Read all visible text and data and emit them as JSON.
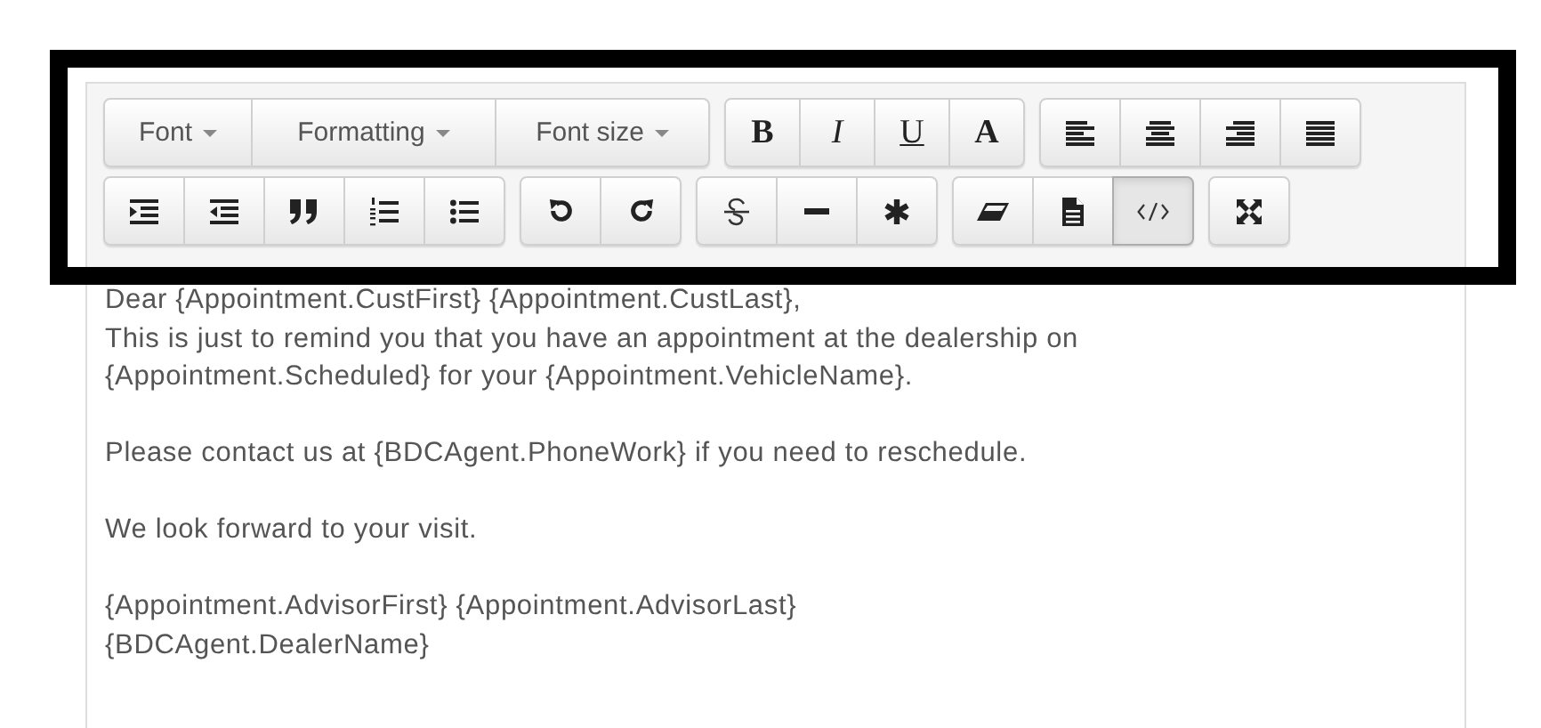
{
  "toolbar": {
    "rows": [
      [
        {
          "buttons": [
            {
              "kind": "dropdown",
              "label": "Font",
              "active": false
            },
            {
              "kind": "dropdown",
              "label": "Formatting",
              "active": false
            },
            {
              "kind": "dropdown",
              "label": "Font size",
              "active": false
            }
          ]
        },
        {
          "buttons": [
            {
              "kind": "letter",
              "label": "B",
              "active": false
            },
            {
              "kind": "letter",
              "label": "I",
              "active": false
            },
            {
              "kind": "letter",
              "label": "U",
              "active": false
            },
            {
              "kind": "letter",
              "label": "A",
              "active": false
            }
          ]
        },
        {
          "buttons": [
            {
              "kind": "icon",
              "active": false
            },
            {
              "kind": "icon",
              "active": false
            },
            {
              "kind": "icon",
              "active": false
            },
            {
              "kind": "icon",
              "active": false
            }
          ]
        }
      ],
      [
        {
          "buttons": [
            {
              "kind": "icon",
              "active": false
            },
            {
              "kind": "icon",
              "active": false
            },
            {
              "kind": "icon",
              "active": false
            },
            {
              "kind": "icon",
              "active": false
            },
            {
              "kind": "icon",
              "active": false
            }
          ]
        },
        {
          "buttons": [
            {
              "kind": "icon",
              "active": false
            },
            {
              "kind": "icon",
              "active": false
            }
          ]
        },
        {
          "buttons": [
            {
              "kind": "icon",
              "active": false
            },
            {
              "kind": "icon",
              "active": false
            },
            {
              "kind": "icon",
              "active": false
            }
          ]
        },
        {
          "buttons": [
            {
              "kind": "icon",
              "active": false
            },
            {
              "kind": "icon",
              "active": false
            },
            {
              "kind": "icon",
              "active": true
            }
          ]
        },
        {
          "buttons": [
            {
              "kind": "icon",
              "active": false
            }
          ]
        }
      ]
    ]
  },
  "body": {
    "paragraphs": [
      [
        "Dear {Appointment.CustFirst} {Appointment.CustLast},",
        "This is just to remind you that you have an appointment at the dealership on",
        "{Appointment.Scheduled} for your {Appointment.VehicleName}."
      ],
      [
        "Please contact us at {BDCAgent.PhoneWork} if you need to reschedule."
      ],
      [
        "We look forward to your visit."
      ],
      [
        "{Appointment.AdvisorFirst} {Appointment.AdvisorLast}",
        "{BDCAgent.DealerName}"
      ]
    ]
  }
}
